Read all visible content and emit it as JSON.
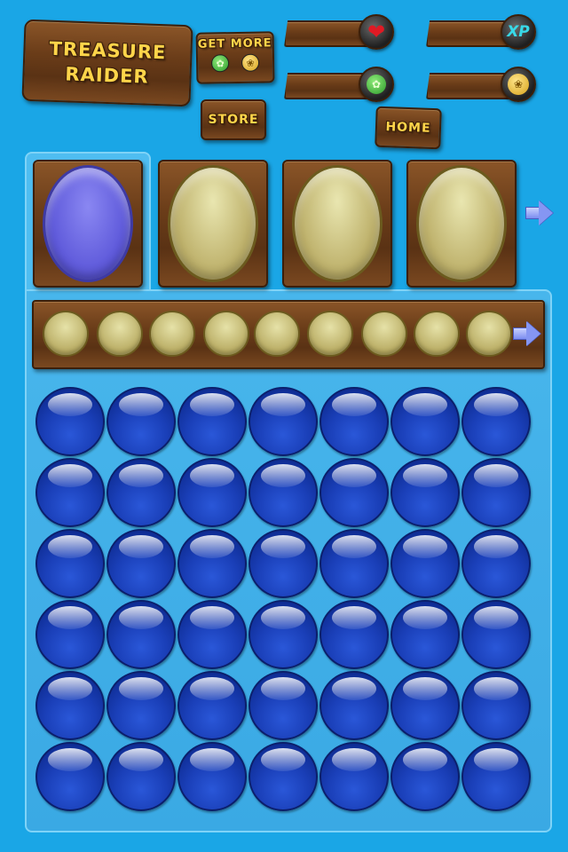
{
  "title": {
    "line1": "TREASURE",
    "line2": "RAIDER"
  },
  "buttons": {
    "get_more": "GET MORE",
    "store": "STORE",
    "home": "HOME"
  },
  "stats": [
    {
      "name": "lives",
      "value": "",
      "icon": "heart-icon",
      "glyph": "❤"
    },
    {
      "name": "experience",
      "value": "",
      "icon": "xp-icon",
      "glyph": "XP"
    },
    {
      "name": "gems",
      "value": "",
      "icon": "green-gem-icon",
      "glyph": "✿"
    },
    {
      "name": "coins",
      "value": "",
      "icon": "gold-coin-icon",
      "glyph": "❀"
    }
  ],
  "card_slots": [
    {
      "state": "selected"
    },
    {
      "state": "empty"
    },
    {
      "state": "empty"
    },
    {
      "state": "empty"
    }
  ],
  "inventory_slot_count": 9,
  "grid": {
    "rows": 6,
    "cols": 7
  },
  "colors": {
    "background": "#1aa6e6",
    "wood": "#6b3d19",
    "gold_text": "#ffd54a",
    "bubble": "#1a3fb8",
    "selected_card": "#6d69e6",
    "empty_slot": "#cfc37f"
  }
}
